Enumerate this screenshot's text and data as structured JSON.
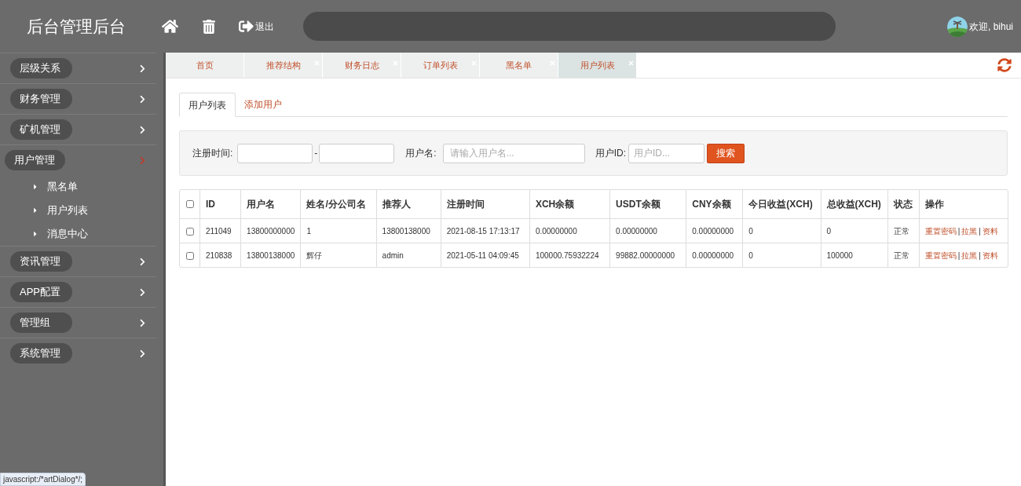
{
  "header": {
    "title": "后台管理后台",
    "logout": "退出",
    "welcome": "欢迎, bihui"
  },
  "sidebar": {
    "items": [
      {
        "label": "层级关系",
        "expanded": false
      },
      {
        "label": "财务管理",
        "expanded": false
      },
      {
        "label": "矿机管理",
        "expanded": false
      },
      {
        "label": "用户管理",
        "expanded": true,
        "children": [
          {
            "label": "黑名单"
          },
          {
            "label": "用户列表"
          },
          {
            "label": "消息中心"
          }
        ]
      },
      {
        "label": "资讯管理",
        "expanded": false
      },
      {
        "label": "APP配置",
        "expanded": false
      },
      {
        "label": "管理组",
        "expanded": false
      },
      {
        "label": "系统管理",
        "expanded": false
      }
    ]
  },
  "page_tabs": [
    {
      "label": "首页",
      "selected": false,
      "closable": false
    },
    {
      "label": "推荐结构",
      "selected": false,
      "closable": true
    },
    {
      "label": "财务日志",
      "selected": false,
      "closable": true
    },
    {
      "label": "订单列表",
      "selected": false,
      "closable": true
    },
    {
      "label": "黑名单",
      "selected": false,
      "closable": true
    },
    {
      "label": "用户列表",
      "selected": true,
      "closable": true
    }
  ],
  "content_tabs": [
    {
      "label": "用户列表",
      "selected": true
    },
    {
      "label": "添加用户",
      "selected": false
    }
  ],
  "filter": {
    "reg_time_label": "注册时间:",
    "separator": "-",
    "username_label": "用户名:",
    "username_placeholder": "请输入用户名...",
    "userid_label": "用户ID:",
    "userid_placeholder": "用户ID...",
    "search_button": "搜索"
  },
  "table": {
    "all_checked": false,
    "action_separator": "|",
    "columns": [
      "ID",
      "用户名",
      "姓名/分公司名",
      "推荐人",
      "注册时间",
      "XCH余额",
      "USDT余额",
      "CNY余额",
      "今日收益(XCH)",
      "总收益(XCH)",
      "状态",
      "操作"
    ],
    "rows": [
      {
        "checked": false,
        "cells": [
          "211049",
          "13800000000",
          "1",
          "13800138000",
          "2021-08-15 17:13:17",
          "0.00000000",
          "0.00000000",
          "0.00000000",
          "0",
          "0",
          "正常"
        ],
        "actions": [
          "重置密码",
          "拉黑",
          "资料"
        ]
      },
      {
        "checked": false,
        "cells": [
          "210838",
          "13800138000",
          "辉仔",
          "admin",
          "2021-05-11 04:09:45",
          "100000.75932224",
          "99882.00000000",
          "0.00000000",
          "0",
          "100000",
          "正常"
        ],
        "actions": [
          "重置密码",
          "拉黑",
          "资料"
        ]
      }
    ]
  },
  "status_bar": "javascript:/*artDialog*/;"
}
